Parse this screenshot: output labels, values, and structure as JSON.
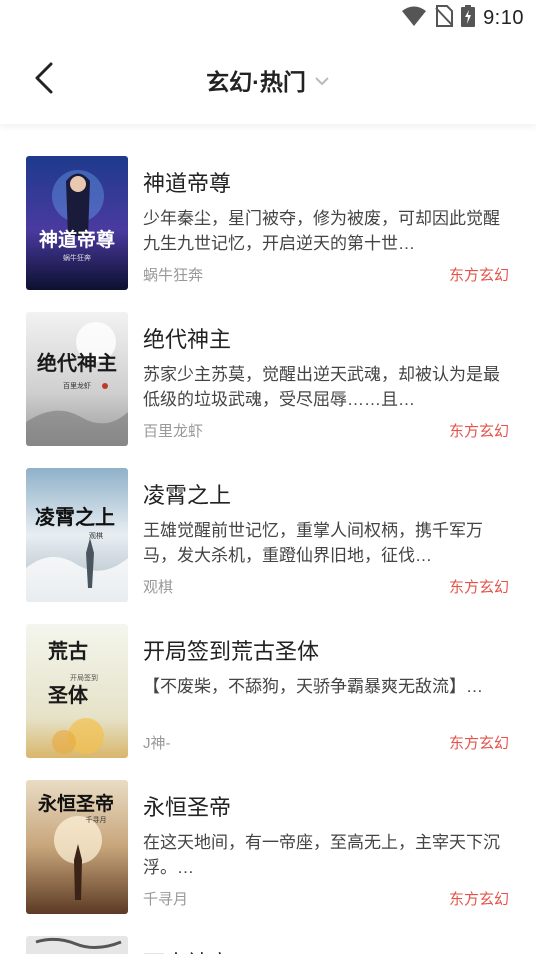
{
  "status": {
    "time": "9:10"
  },
  "header": {
    "title": "玄幻·热门"
  },
  "books": [
    {
      "title": "神道帝尊",
      "desc": "少年秦尘，星门被夺，修为被废，可却因此觉醒九生九世记忆，开启逆天的第十世…",
      "author": "蜗牛狂奔",
      "tag": "东方玄幻",
      "cover_text": "神道帝尊",
      "cover_author": "蜗牛狂奔"
    },
    {
      "title": "绝代神主",
      "desc": "苏家少主苏莫，觉醒出逆天武魂，却被认为是最低级的垃圾武魂，受尽屈辱……且…",
      "author": "百里龙虾",
      "tag": "东方玄幻",
      "cover_text": "绝代神主",
      "cover_author": "百里龙虾"
    },
    {
      "title": "凌霄之上",
      "desc": "王雄觉醒前世记忆，重掌人间权柄，携千军万马，发大杀机，重蹬仙界旧地，征伐…",
      "author": "观棋",
      "tag": "东方玄幻",
      "cover_text": "凌霄之上",
      "cover_author": "观棋"
    },
    {
      "title": "开局签到荒古圣体",
      "desc": "【不废柴，不舔狗，天骄争霸暴爽无敌流】…",
      "author": "J神-",
      "tag": "东方玄幻",
      "cover_text": "荒古圣体",
      "cover_author": "开局签到"
    },
    {
      "title": "永恒圣帝",
      "desc": "在这天地间，有一帝座，至高无上，主宰天下沉浮。…",
      "author": "千寻月",
      "tag": "东方玄幻",
      "cover_text": "永恒圣帝",
      "cover_author": "千寻月"
    }
  ],
  "partial_next": {
    "title": "万古神帝"
  }
}
